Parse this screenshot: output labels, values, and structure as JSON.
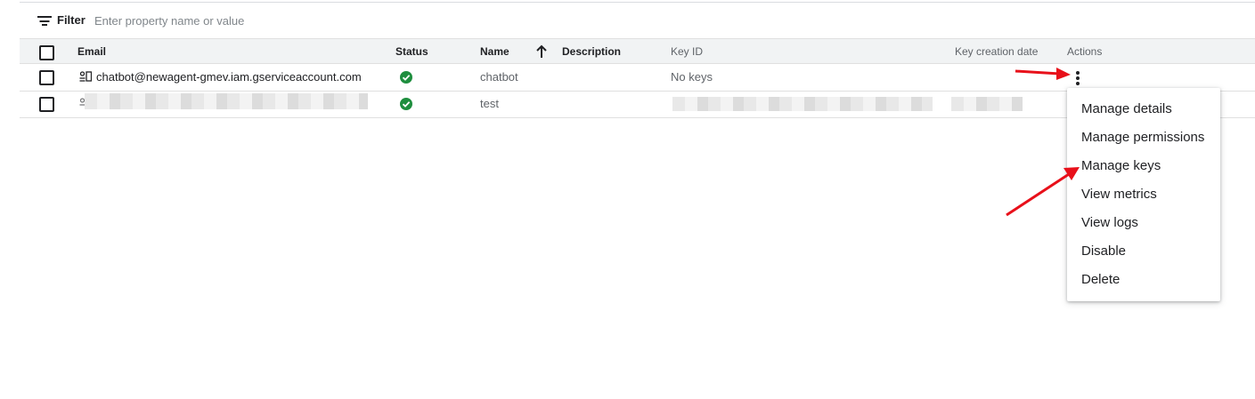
{
  "filter": {
    "label": "Filter",
    "placeholder": "Enter property name or value"
  },
  "columns": {
    "email": "Email",
    "status": "Status",
    "name": "Name",
    "description": "Description",
    "key_id": "Key ID",
    "key_creation_date": "Key creation date",
    "actions": "Actions"
  },
  "rows": [
    {
      "email": "chatbot@newagent-gmev.iam.gserviceaccount.com",
      "status": "Enabled",
      "name": "chatbot",
      "description": "",
      "key_id": "No keys",
      "key_creation_date": ""
    },
    {
      "email": "",
      "status": "Enabled",
      "name": "test",
      "description": "",
      "key_id": "",
      "key_creation_date": ""
    }
  ],
  "menu": {
    "items": [
      "Manage details",
      "Manage permissions",
      "Manage keys",
      "View metrics",
      "View logs",
      "Disable",
      "Delete"
    ]
  },
  "colors": {
    "status_ok": "#1e8e3e",
    "annotation_arrow": "#e8101a",
    "header_bg": "#f1f3f4"
  },
  "icons": {
    "filter": "filter-lines-icon",
    "sort": "arrow-up-icon",
    "service_account": "service-account-icon",
    "status": "check-circle-icon",
    "actions": "more-vert-icon"
  }
}
